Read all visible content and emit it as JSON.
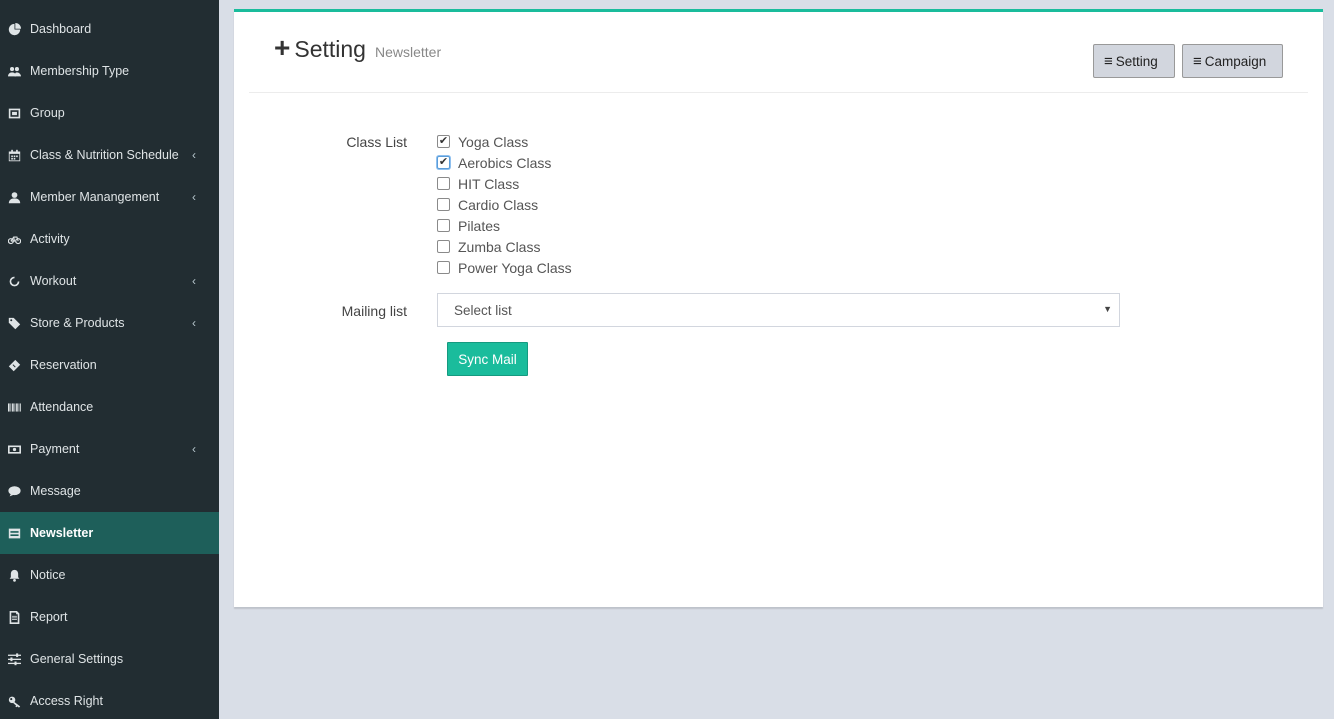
{
  "sidebar": {
    "items": [
      {
        "label": "Dashboard",
        "icon": "dashboard-icon",
        "chevron": false
      },
      {
        "label": "Membership Type",
        "icon": "users-icon",
        "chevron": false
      },
      {
        "label": "Group",
        "icon": "group-icon",
        "chevron": false
      },
      {
        "label": "Class & Nutrition Schedule",
        "icon": "calendar-icon",
        "chevron": true
      },
      {
        "label": "Member Manangement",
        "icon": "user-icon",
        "chevron": true
      },
      {
        "label": "Activity",
        "icon": "bicycle-icon",
        "chevron": false
      },
      {
        "label": "Workout",
        "icon": "workout-icon",
        "chevron": true
      },
      {
        "label": "Store & Products",
        "icon": "tags-icon",
        "chevron": true
      },
      {
        "label": "Reservation",
        "icon": "ticket-icon",
        "chevron": false
      },
      {
        "label": "Attendance",
        "icon": "barcode-icon",
        "chevron": false
      },
      {
        "label": "Payment",
        "icon": "money-icon",
        "chevron": true
      },
      {
        "label": "Message",
        "icon": "comment-icon",
        "chevron": false
      },
      {
        "label": "Newsletter",
        "icon": "envelope-icon",
        "chevron": false,
        "active": true
      },
      {
        "label": "Notice",
        "icon": "bell-icon",
        "chevron": false
      },
      {
        "label": "Report",
        "icon": "report-icon",
        "chevron": false
      },
      {
        "label": "General Settings",
        "icon": "sliders-icon",
        "chevron": false
      },
      {
        "label": "Access Right",
        "icon": "key-icon",
        "chevron": false
      }
    ],
    "chevron_glyph": "‹"
  },
  "header": {
    "plus_glyph": "+",
    "title": "Setting",
    "subtitle": "Newsletter",
    "setting_button": "Setting",
    "campaign_button": "Campaign",
    "bars_glyph": "≡"
  },
  "form": {
    "class_list_label": "Class List",
    "classes": [
      {
        "label": "Yoga Class",
        "checked": true
      },
      {
        "label": "Aerobics Class",
        "checked": true
      },
      {
        "label": "HIT Class",
        "checked": false
      },
      {
        "label": "Cardio Class",
        "checked": false
      },
      {
        "label": "Pilates",
        "checked": false
      },
      {
        "label": "Zumba Class",
        "checked": false
      },
      {
        "label": "Power Yoga Class",
        "checked": false
      }
    ],
    "check_glyph": "✔",
    "mailing_list_label": "Mailing list",
    "mailing_list_selected": "Select list",
    "select_arrow": "▼",
    "sync_button": "Sync Mail"
  },
  "colors": {
    "sidebar_bg": "#222d32",
    "active_bg": "#1e5f5a",
    "accent": "#1abc9c",
    "page_bg": "#d9dee7"
  }
}
